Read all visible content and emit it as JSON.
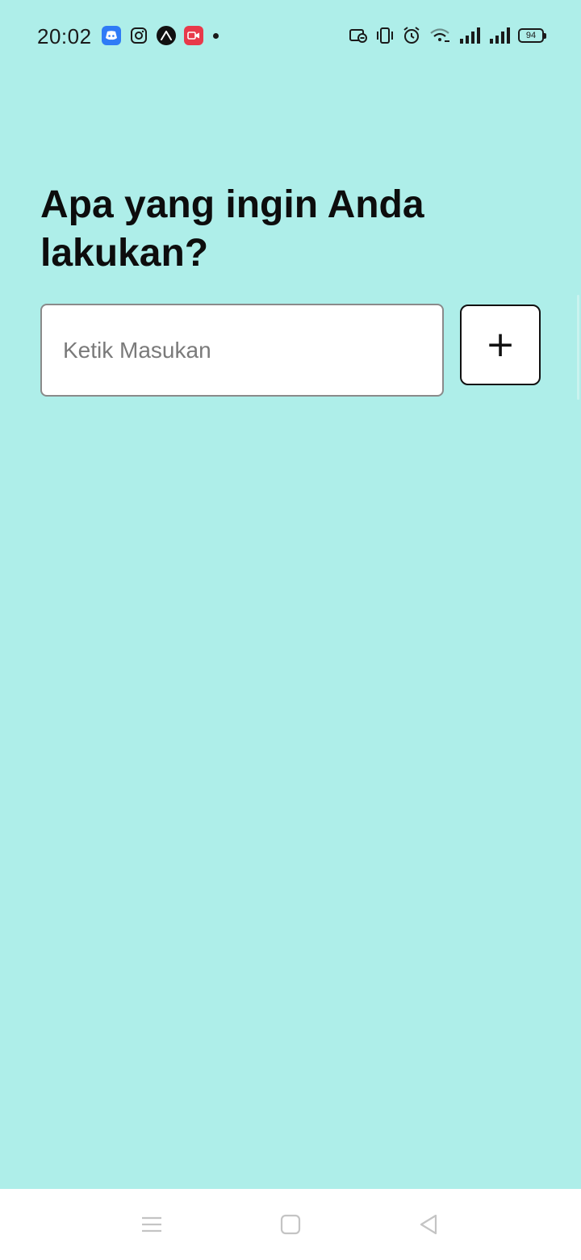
{
  "status_bar": {
    "time": "20:02",
    "battery_level": "94",
    "notification_icons": [
      "discord-icon",
      "instagram-icon",
      "expo-icon",
      "screen-recorder-icon"
    ],
    "system_icons": [
      "do-not-disturb-icon",
      "vibrate-icon",
      "alarm-icon",
      "wifi-icon",
      "signal-icon",
      "signal-icon",
      "battery-icon"
    ]
  },
  "main": {
    "heading": "Apa yang ingin Anda lakukan?",
    "input": {
      "placeholder": "Ketik Masukan",
      "value": ""
    },
    "add_button_label": "+"
  },
  "nav_bar": {
    "buttons": [
      "menu-icon",
      "home-icon",
      "back-icon"
    ]
  },
  "colors": {
    "background": "#aeeee9",
    "surface": "#ffffff",
    "text": "#0d0d0d",
    "discord": "#5865f2",
    "recorder": "#e8394a"
  }
}
